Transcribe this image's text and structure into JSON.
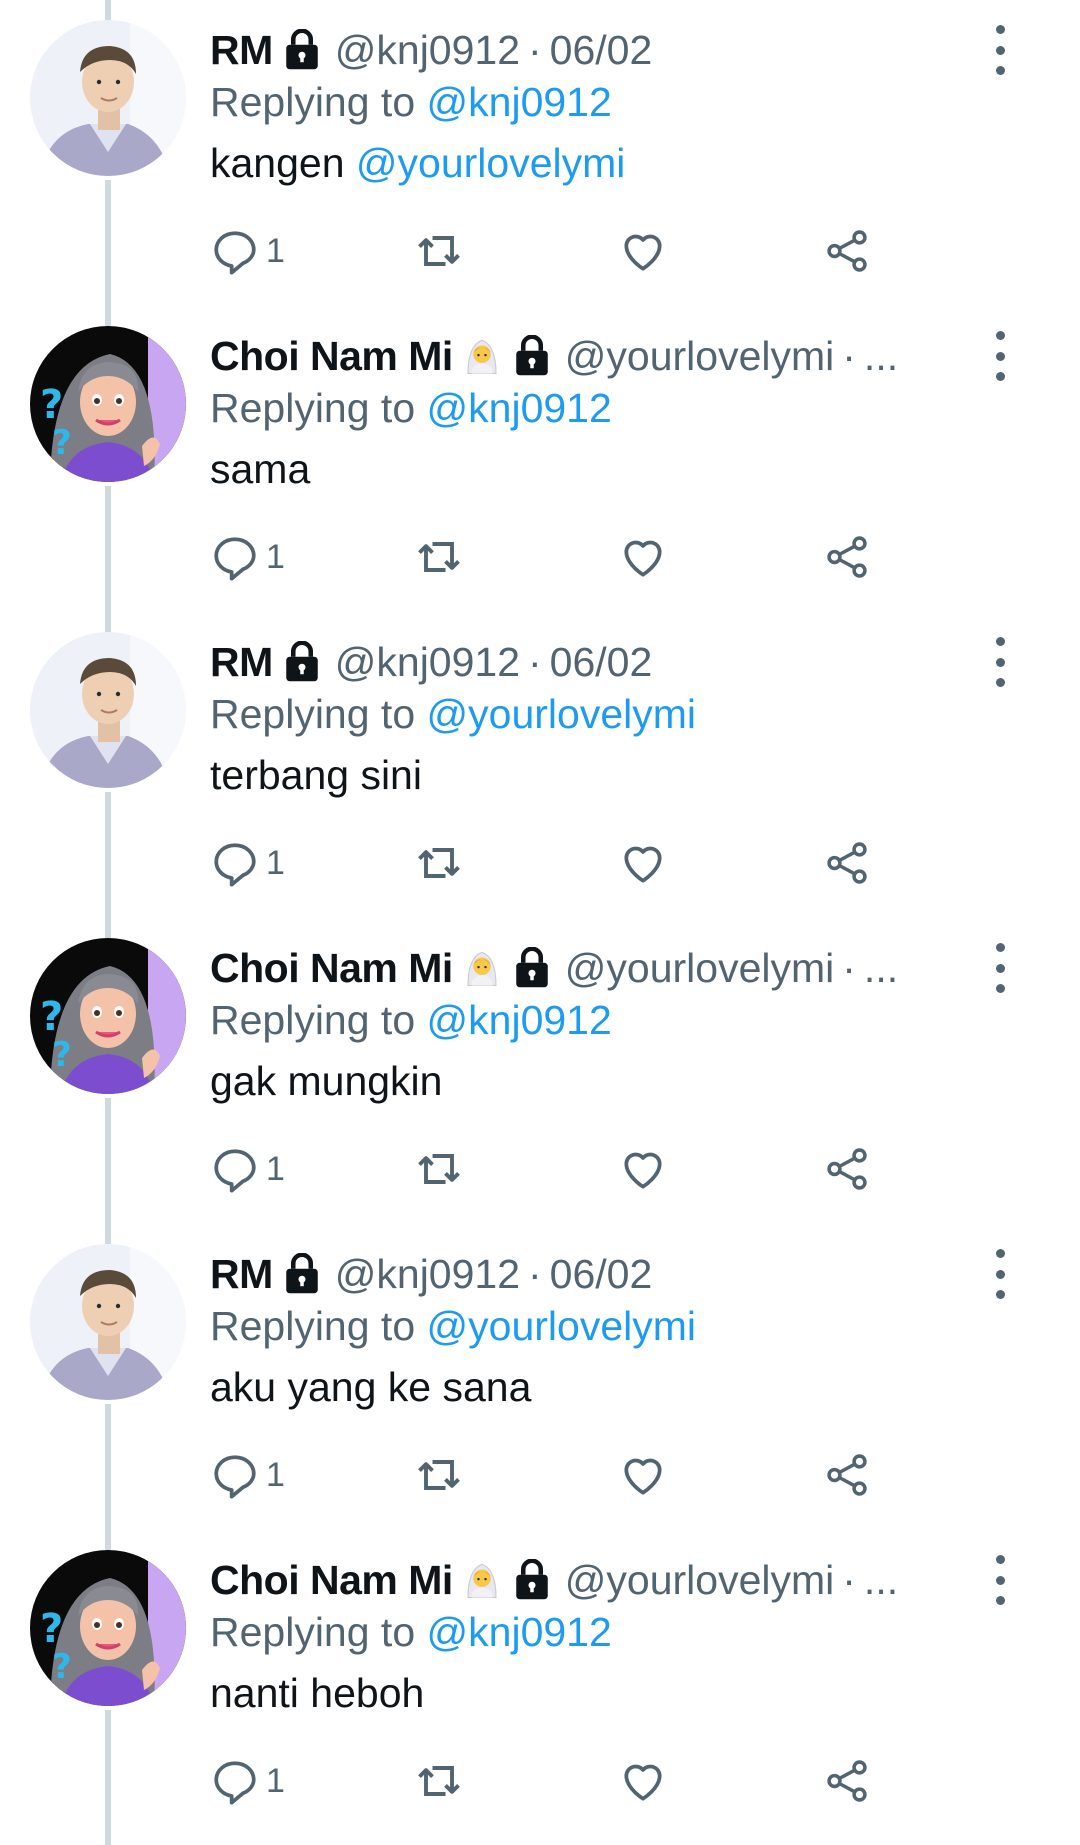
{
  "tweets": [
    {
      "author": "RM",
      "handle": "@knj0912",
      "sep": "·",
      "date": "06/02",
      "replying_prefix": "Replying to",
      "replying_to": "@knj0912",
      "text_before": "kangen ",
      "text_mention": "@yourlovelymi",
      "reply_count": "1",
      "avatar": "rm-avatar",
      "has_badge": false
    },
    {
      "author": "Choi Nam Mi",
      "handle": "@yourlovelymi",
      "sep": "·",
      "date": "...",
      "replying_prefix": "Replying to",
      "replying_to": "@knj0912",
      "text_before": "sama",
      "text_mention": "",
      "reply_count": "1",
      "avatar": "choi-avatar",
      "has_badge": true
    },
    {
      "author": "RM",
      "handle": "@knj0912",
      "sep": "·",
      "date": "06/02",
      "replying_prefix": "Replying to",
      "replying_to": "@yourlovelymi",
      "text_before": "terbang sini",
      "text_mention": "",
      "reply_count": "1",
      "avatar": "rm-avatar",
      "has_badge": false
    },
    {
      "author": "Choi Nam Mi",
      "handle": "@yourlovelymi",
      "sep": "·",
      "date": "...",
      "replying_prefix": "Replying to",
      "replying_to": "@knj0912",
      "text_before": "gak mungkin",
      "text_mention": "",
      "reply_count": "1",
      "avatar": "choi-avatar",
      "has_badge": true
    },
    {
      "author": "RM",
      "handle": "@knj0912",
      "sep": "·",
      "date": "06/02",
      "replying_prefix": "Replying to",
      "replying_to": "@yourlovelymi",
      "text_before": "aku yang ke sana",
      "text_mention": "",
      "reply_count": "1",
      "avatar": "rm-avatar",
      "has_badge": false
    },
    {
      "author": "Choi Nam Mi",
      "handle": "@yourlovelymi",
      "sep": "·",
      "date": "...",
      "replying_prefix": "Replying to",
      "replying_to": "@knj0912",
      "text_before": "nanti heboh",
      "text_mention": "",
      "reply_count": "1",
      "avatar": "choi-avatar",
      "has_badge": true
    }
  ],
  "icons": {
    "protected": "lock-icon",
    "badge": "bride-emoji-icon",
    "reply": "reply-icon",
    "retweet": "retweet-icon",
    "like": "heart-icon",
    "share": "share-icon",
    "more": "more-options-icon"
  },
  "colors": {
    "text": "#0f1419",
    "secondary": "#536471",
    "link": "#1d9bf0",
    "thread_line": "#cfd9de"
  }
}
